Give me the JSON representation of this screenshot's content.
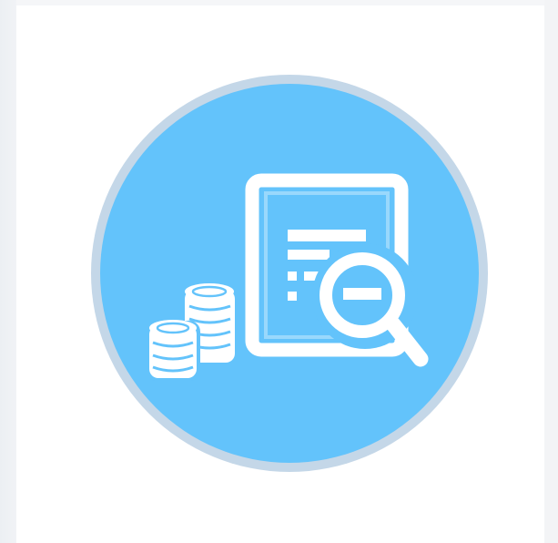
{
  "illustration": {
    "subject": "coins-and-document-with-magnifier-icon",
    "colors": {
      "circle_fill": "#63c3fb",
      "circle_ring": "#c4d7e8",
      "glyph": "#ffffff",
      "card": "#ffffff",
      "page_background": "#eef1f5"
    }
  }
}
